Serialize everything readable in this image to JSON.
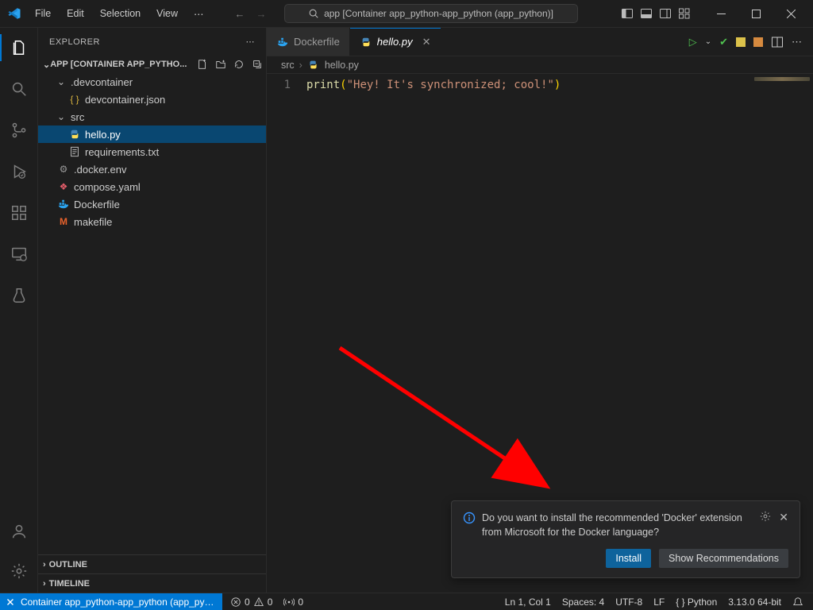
{
  "menubar": {
    "file": "File",
    "edit": "Edit",
    "selection": "Selection",
    "view": "View"
  },
  "command_center": {
    "text": "app [Container app_python-app_python (app_python)]"
  },
  "sidebar": {
    "header": "EXPLORER",
    "root_label": "APP [CONTAINER APP_PYTHO...",
    "devcontainer_folder": ".devcontainer",
    "devcontainer_json": "devcontainer.json",
    "src_folder": "src",
    "hello_py": "hello.py",
    "requirements_txt": "requirements.txt",
    "docker_env": ".docker.env",
    "compose_yaml": "compose.yaml",
    "dockerfile": "Dockerfile",
    "makefile": "makefile",
    "outline": "OUTLINE",
    "timeline": "TIMELINE"
  },
  "tabs": {
    "dockerfile": "Dockerfile",
    "hello": "hello.py"
  },
  "breadcrumb": {
    "seg1": "src",
    "seg2": "hello.py"
  },
  "code": {
    "ln1_num": "1",
    "fn": "print",
    "par_open": "(",
    "str": "\"Hey! It's synchronized; cool!\"",
    "par_close": ")"
  },
  "toast": {
    "message": "Do you want to install the recommended 'Docker' extension from Microsoft for the Docker language?",
    "install": "Install",
    "show_rec": "Show Recommendations"
  },
  "statusbar": {
    "remote": "Container app_python-app_python (app_pyt...",
    "errors": "0",
    "warnings": "0",
    "ports": "0",
    "lncol": "Ln 1, Col 1",
    "spaces": "Spaces: 4",
    "encoding": "UTF-8",
    "eol": "LF",
    "lang": "{ }  Python",
    "interpreter": "3.13.0 64-bit"
  }
}
